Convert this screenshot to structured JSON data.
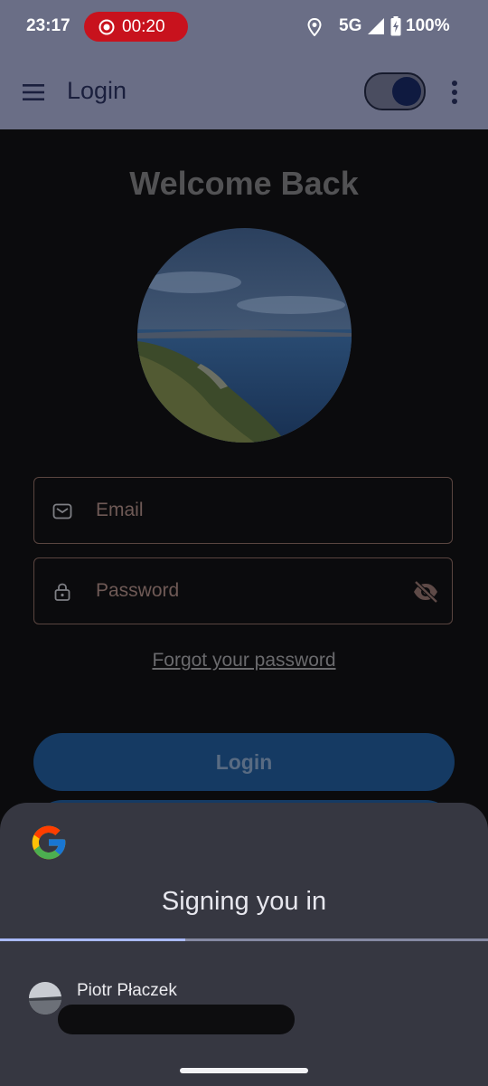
{
  "status_bar": {
    "time": "23:17",
    "recording_timer": "00:20",
    "network": "5G",
    "battery": "100%",
    "icons": [
      "record-icon",
      "location-icon",
      "signal-icon",
      "battery-charging-icon"
    ]
  },
  "app_bar": {
    "title": "Login",
    "menu_icon": "hamburger-menu-icon",
    "theme_toggle_on": true,
    "overflow_icon": "more-vert-icon"
  },
  "login": {
    "heading": "Welcome Back",
    "email_placeholder": "Email",
    "password_placeholder": "Password",
    "forgot_link": "Forgot your password",
    "login_button": "Login"
  },
  "google_sheet": {
    "logo": "google-g-logo",
    "title": "Signing you in",
    "progress": 0.38,
    "account_name": "Piotr Płaczek"
  },
  "colors": {
    "status_bar_bg": "#6a6e86",
    "recording_red": "#c8121d",
    "sheet_bg": "#363741",
    "progress_accent": "#a9b9ff",
    "login_button_bg": "#153a63"
  }
}
